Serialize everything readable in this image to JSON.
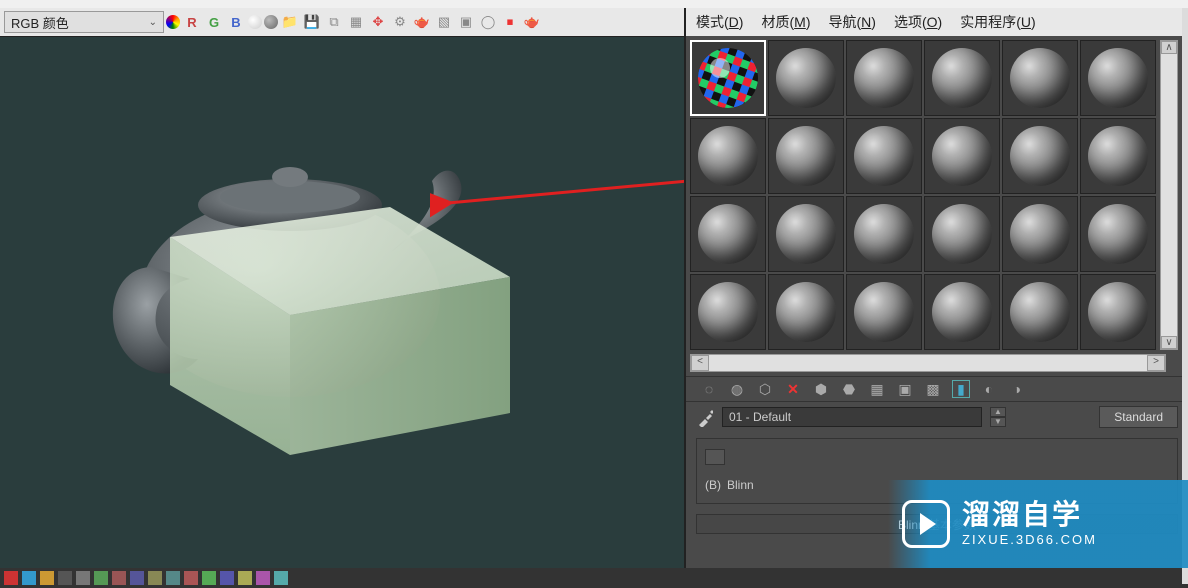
{
  "left_toolbar": {
    "mode_label": "RGB 颜色",
    "icons": [
      "palette",
      "R",
      "G",
      "B",
      "sphere-white",
      "sphere-grey",
      "folder",
      "save",
      "copy",
      "frame",
      "move",
      "gear",
      "teapot-tool",
      "box1",
      "box2",
      "render",
      "stop",
      "teapot2"
    ]
  },
  "menu": {
    "items": [
      {
        "label": "模式",
        "accel": "D"
      },
      {
        "label": "材质",
        "accel": "M"
      },
      {
        "label": "导航",
        "accel": "N"
      },
      {
        "label": "选项",
        "accel": "O"
      },
      {
        "label": "实用程序",
        "accel": "U"
      }
    ]
  },
  "slots": {
    "rows": 4,
    "cols": 6,
    "selected_index": 0
  },
  "material_toolbar": {
    "icons": [
      "assign1",
      "assign2",
      "put",
      "delete",
      "get1",
      "get2",
      "show",
      "bg",
      "grid",
      "showmap",
      "options",
      "more"
    ]
  },
  "material": {
    "current_name": "01 - Default",
    "type_button": "Standard"
  },
  "shader": {
    "label_prefix": "(B)",
    "value": "Blinn"
  },
  "rollouts": {
    "blinn_basic": "Blinn 基本参数"
  },
  "watermark": {
    "cn": "溜溜自学",
    "en": "ZIXUE.3D66.COM"
  },
  "colors": {
    "arrow": "#e02020"
  }
}
